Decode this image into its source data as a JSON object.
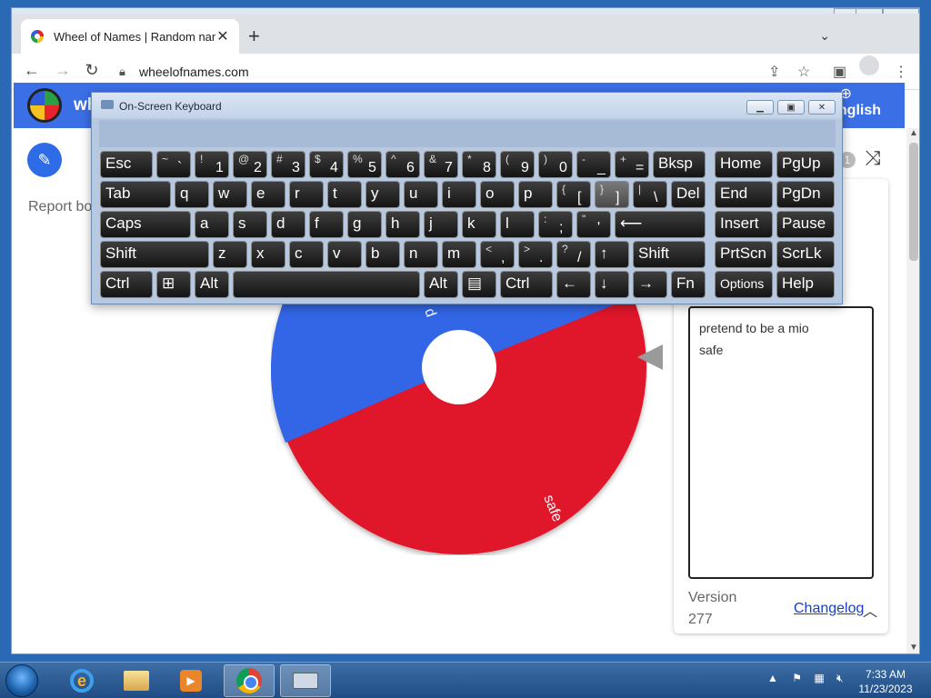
{
  "browser": {
    "tab_title": "Wheel of Names | Random name",
    "url": "wheelofnames.com"
  },
  "app": {
    "brand": "wh",
    "language": "nglish",
    "report_text": "Report bo",
    "badge_count": "1"
  },
  "wheel": {
    "segments": [
      {
        "label": "p",
        "color": "#3366e6"
      },
      {
        "label": "safe",
        "color": "#e0162b"
      }
    ]
  },
  "entries": {
    "text": "pretend to be a mio\nsafe",
    "version_label": "Version",
    "version_number": "277",
    "changelog_label": "Changelog"
  },
  "osk": {
    "title": "On-Screen Keyboard",
    "rows": [
      [
        {
          "label": "Esc",
          "w": 58
        },
        {
          "shift": "~",
          "ch": "`",
          "w": 38
        },
        {
          "shift": "!",
          "ch": "1",
          "w": 38
        },
        {
          "shift": "@",
          "ch": "2",
          "w": 38
        },
        {
          "shift": "#",
          "ch": "3",
          "w": 38
        },
        {
          "shift": "$",
          "ch": "4",
          "w": 38
        },
        {
          "shift": "%",
          "ch": "5",
          "w": 38
        },
        {
          "shift": "^",
          "ch": "6",
          "w": 38
        },
        {
          "shift": "&",
          "ch": "7",
          "w": 38
        },
        {
          "shift": "*",
          "ch": "8",
          "w": 38
        },
        {
          "shift": "(",
          "ch": "9",
          "w": 38
        },
        {
          "shift": ")",
          "ch": "0",
          "w": 38
        },
        {
          "shift": "-",
          "ch": "_",
          "w": 38
        },
        {
          "shift": "+",
          "ch": "=",
          "w": 38
        },
        {
          "label": "Bksp",
          "w": 58
        }
      ],
      [
        {
          "label": "Tab",
          "w": 78
        },
        {
          "label": "q",
          "w": 38
        },
        {
          "label": "w",
          "w": 38
        },
        {
          "label": "e",
          "w": 38
        },
        {
          "label": "r",
          "w": 38
        },
        {
          "label": "t",
          "w": 38
        },
        {
          "label": "y",
          "w": 38
        },
        {
          "label": "u",
          "w": 38
        },
        {
          "label": "i",
          "w": 38
        },
        {
          "label": "o",
          "w": 38
        },
        {
          "label": "p",
          "w": 38
        },
        {
          "shift": "{",
          "ch": "[",
          "w": 38
        },
        {
          "shift": "}",
          "ch": "]",
          "w": 38,
          "hover": true
        },
        {
          "shift": "|",
          "ch": "\\",
          "w": 38
        },
        {
          "label": "Del",
          "w": 38
        }
      ],
      [
        {
          "label": "Caps",
          "w": 100
        },
        {
          "label": "a",
          "w": 38
        },
        {
          "label": "s",
          "w": 38
        },
        {
          "label": "d",
          "w": 38
        },
        {
          "label": "f",
          "w": 38
        },
        {
          "label": "g",
          "w": 38
        },
        {
          "label": "h",
          "w": 38
        },
        {
          "label": "j",
          "w": 38
        },
        {
          "label": "k",
          "w": 38
        },
        {
          "label": "l",
          "w": 38
        },
        {
          "shift": ":",
          "ch": ";",
          "w": 38
        },
        {
          "shift": "\"",
          "ch": "'",
          "w": 38
        },
        {
          "label": "⟵",
          "w": 100
        }
      ],
      [
        {
          "label": "Shift",
          "w": 120
        },
        {
          "label": "z",
          "w": 38
        },
        {
          "label": "x",
          "w": 38
        },
        {
          "label": "c",
          "w": 38
        },
        {
          "label": "v",
          "w": 38
        },
        {
          "label": "b",
          "w": 38
        },
        {
          "label": "n",
          "w": 38
        },
        {
          "label": "m",
          "w": 38
        },
        {
          "shift": "<",
          "ch": ",",
          "w": 38
        },
        {
          "shift": ">",
          "ch": ".",
          "w": 38
        },
        {
          "shift": "?",
          "ch": "/",
          "w": 38
        },
        {
          "label": "↑",
          "w": 38
        },
        {
          "label": "Shift",
          "w": 80
        }
      ],
      [
        {
          "label": "Ctrl",
          "w": 58
        },
        {
          "label": "⊞",
          "w": 38
        },
        {
          "label": "Alt",
          "w": 38
        },
        {
          "label": "",
          "w": 206
        },
        {
          "label": "Alt",
          "w": 38
        },
        {
          "label": "▤",
          "w": 38
        },
        {
          "label": "Ctrl",
          "w": 58
        },
        {
          "label": "←",
          "w": 38
        },
        {
          "label": "↓",
          "w": 38
        },
        {
          "label": "→",
          "w": 38
        },
        {
          "label": "Fn",
          "w": 38
        }
      ]
    ],
    "side_rows": [
      [
        {
          "label": "Home"
        },
        {
          "label": "PgUp"
        }
      ],
      [
        {
          "label": "End"
        },
        {
          "label": "PgDn"
        }
      ],
      [
        {
          "label": "Insert"
        },
        {
          "label": "Pause"
        }
      ],
      [
        {
          "label": "PrtScn"
        },
        {
          "label": "ScrLk"
        }
      ],
      [
        {
          "label": "Options",
          "small": true
        },
        {
          "label": "Help"
        }
      ]
    ]
  },
  "taskbar": {
    "time": "7:33 AM",
    "date": "11/23/2023"
  },
  "icons": {
    "tab_close": "close-icon",
    "new_tab": "plus-icon",
    "back": "arrow-left-icon",
    "forward": "arrow-right-icon",
    "reload": "reload-icon",
    "lock": "lock-icon",
    "share": "share-icon",
    "bookmark": "star-icon",
    "sidepanel": "sidepanel-icon",
    "profile": "profile-icon",
    "menu": "kebab-menu-icon",
    "edit": "pencil-icon",
    "shuffle": "shuffle-icon",
    "globe": "globe-icon"
  }
}
